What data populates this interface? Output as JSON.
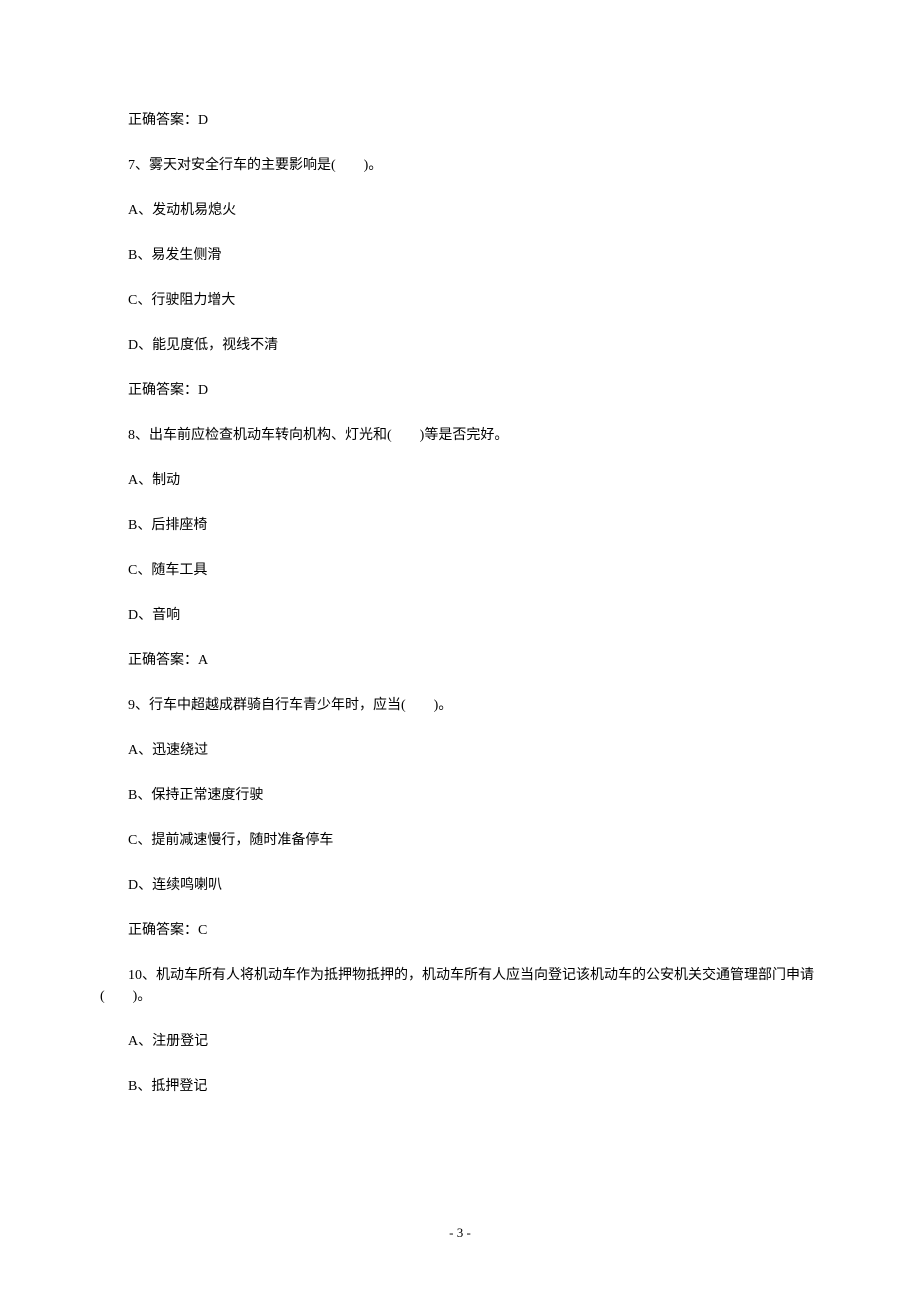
{
  "q6_answer": "正确答案：D",
  "q7_text": "7、雾天对安全行车的主要影响是(　　)。",
  "q7_A": "A、发动机易熄火",
  "q7_B": "B、易发生侧滑",
  "q7_C": "C、行驶阻力增大",
  "q7_D": "D、能见度低，视线不清",
  "q7_answer": "正确答案：D",
  "q8_text": "8、出车前应检查机动车转向机构、灯光和(　　)等是否完好。",
  "q8_A": "A、制动",
  "q8_B": "B、后排座椅",
  "q8_C": "C、随车工具",
  "q8_D": "D、音响",
  "q8_answer": "正确答案：A",
  "q9_text": "9、行车中超越成群骑自行车青少年时，应当(　　)。",
  "q9_A": "A、迅速绕过",
  "q9_B": "B、保持正常速度行驶",
  "q9_C": "C、提前减速慢行，随时准备停车",
  "q9_D": "D、连续鸣喇叭",
  "q9_answer": "正确答案：C",
  "q10_text": "10、机动车所有人将机动车作为抵押物抵押的，机动车所有人应当向登记该机动车的公安机关交通管理部门申请(　　)。",
  "q10_A": "A、注册登记",
  "q10_B": "B、抵押登记",
  "page_number": "- 3 -"
}
